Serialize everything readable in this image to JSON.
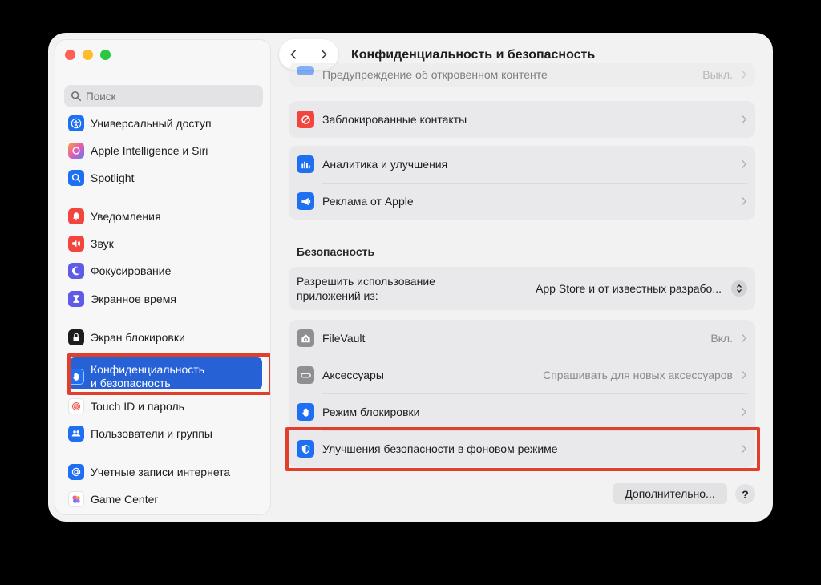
{
  "window": {
    "title": "Конфиденциальность и безопасность"
  },
  "search": {
    "placeholder": "Поиск"
  },
  "sidebar": {
    "items": [
      {
        "label": "Универсальный доступ",
        "icon": "accessibility-icon",
        "color": "#1e6ff2"
      },
      {
        "label": "Apple Intelligence и Siri",
        "icon": "siri-icon",
        "color": "#c86ad8"
      },
      {
        "label": "Spotlight",
        "icon": "magnifier-icon",
        "color": "#1e6ff2"
      },
      {
        "label": "Уведомления",
        "icon": "bell-icon",
        "color": "#f1453d"
      },
      {
        "label": "Звук",
        "icon": "speaker-icon",
        "color": "#f1453d"
      },
      {
        "label": "Фокусирование",
        "icon": "moon-icon",
        "color": "#5e5ce6"
      },
      {
        "label": "Экранное время",
        "icon": "hourglass-icon",
        "color": "#5e5ce6"
      },
      {
        "label": "Экран блокировки",
        "icon": "lock-icon",
        "color": "#1d1d1f"
      },
      {
        "label": "Конфиденциальность\nи безопасность",
        "icon": "hand-icon",
        "color": "#1e6ff2"
      },
      {
        "label": "Touch ID и пароль",
        "icon": "fingerprint-icon",
        "color": "#ffffff"
      },
      {
        "label": "Пользователи и группы",
        "icon": "users-icon",
        "color": "#1e6ff2"
      },
      {
        "label": "Учетные записи интернета",
        "icon": "at-icon",
        "color": "#1e6ff2"
      },
      {
        "label": "Game Center",
        "icon": "game-center-icon",
        "color": "#ffffff"
      }
    ]
  },
  "content": {
    "partial_row": {
      "label": "Предупреждение об откровенном контенте",
      "value": "Выкл."
    },
    "blocked": {
      "label": "Заблокированные контакты"
    },
    "analytics": {
      "label": "Аналитика и улучшения"
    },
    "ads": {
      "label": "Реклама от Apple"
    },
    "security_section": "Безопасность",
    "allow_apps": {
      "label": "Разрешить использование приложений из:",
      "value": "App Store и от известных разрабо..."
    },
    "filevault": {
      "label": "FileVault",
      "value": "Вкл."
    },
    "accessories": {
      "label": "Аксессуары",
      "value": "Спрашивать для новых аксессуаров"
    },
    "lockdown": {
      "label": "Режим блокировки"
    },
    "bg_security": {
      "label": "Улучшения безопасности в фоновом режиме"
    }
  },
  "buttons": {
    "more": "Дополнительно...",
    "help": "?"
  },
  "colors": {
    "accent": "#2761d6",
    "highlight": "#e0402b"
  }
}
